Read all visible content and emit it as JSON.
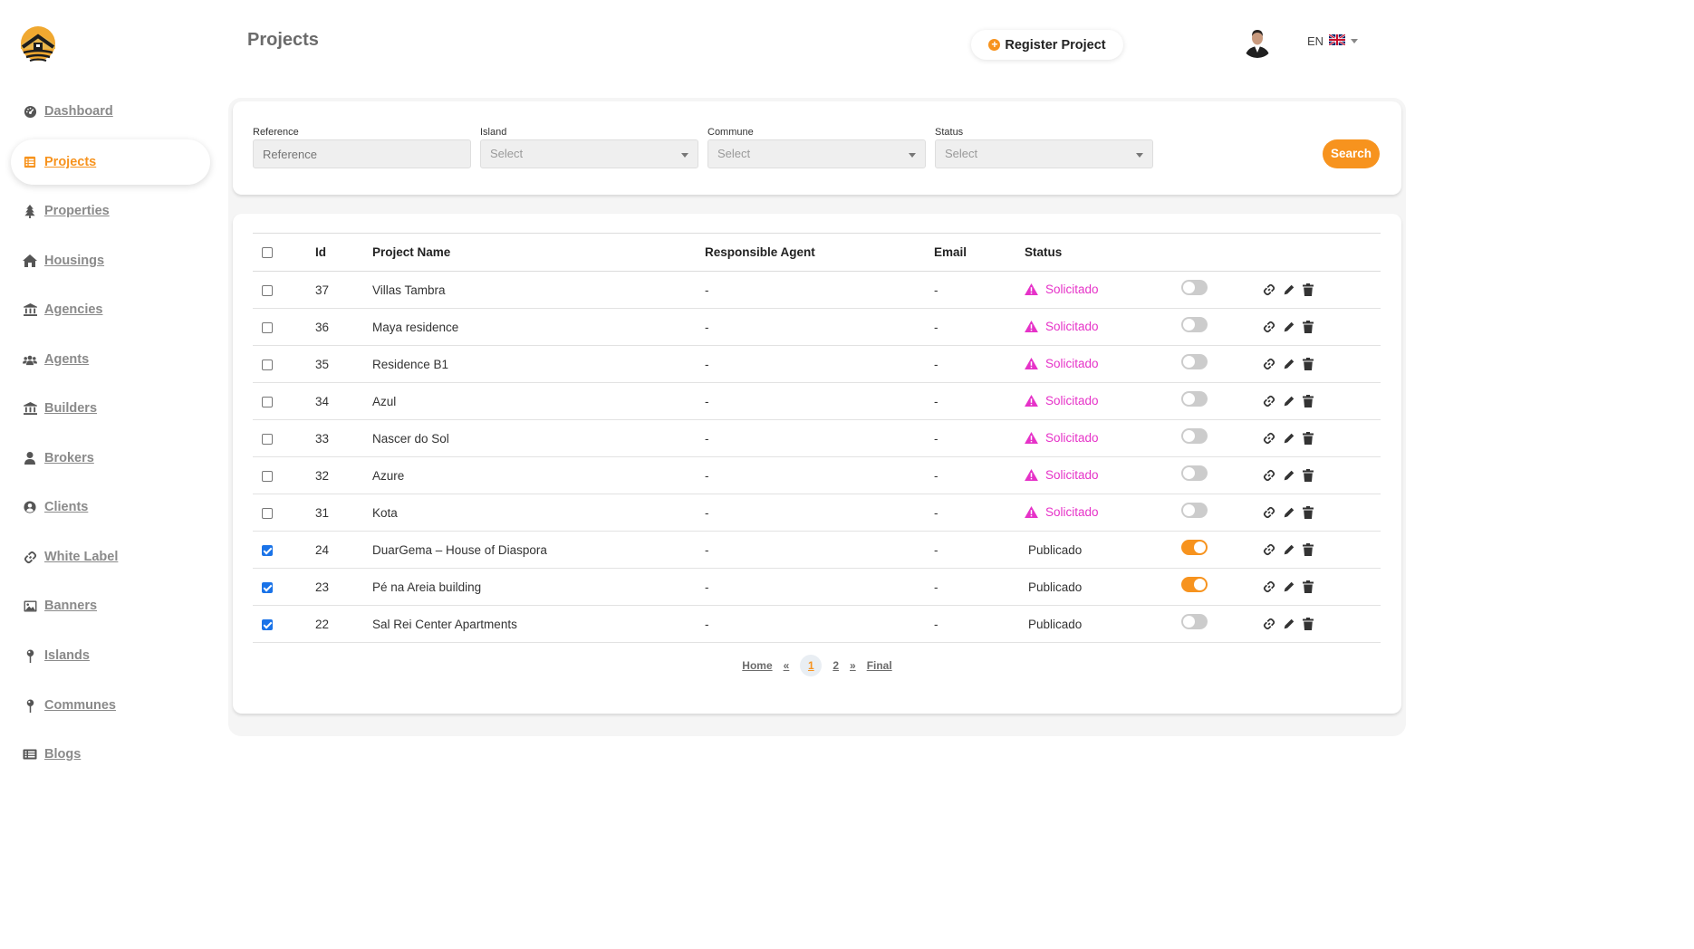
{
  "sidebar": {
    "items": [
      {
        "label": "Dashboard",
        "icon": "gauge-icon"
      },
      {
        "label": "Projects",
        "icon": "list-icon",
        "active": true
      },
      {
        "label": "Properties",
        "icon": "tree-icon"
      },
      {
        "label": "Housings",
        "icon": "house-icon"
      },
      {
        "label": "Agencies",
        "icon": "bank-icon"
      },
      {
        "label": "Agents",
        "icon": "users-icon"
      },
      {
        "label": "Builders",
        "icon": "bank-icon"
      },
      {
        "label": "Brokers",
        "icon": "user-icon"
      },
      {
        "label": "Clients",
        "icon": "user-circle-icon"
      },
      {
        "label": "White Label",
        "icon": "link-icon"
      },
      {
        "label": "Banners",
        "icon": "image-icon"
      },
      {
        "label": "Islands",
        "icon": "pin-icon"
      },
      {
        "label": "Communes",
        "icon": "pin-icon"
      },
      {
        "label": "Blogs",
        "icon": "list-alt-icon"
      }
    ]
  },
  "header": {
    "title": "Projects",
    "register_label": "Register Project",
    "lang": "EN"
  },
  "filters": {
    "reference": {
      "label": "Reference",
      "placeholder": "Reference"
    },
    "island": {
      "label": "Island",
      "value": "Select"
    },
    "commune": {
      "label": "Commune",
      "value": "Select"
    },
    "status": {
      "label": "Status",
      "value": "Select"
    },
    "search_label": "Search"
  },
  "table": {
    "headers": {
      "id": "Id",
      "name": "Project Name",
      "agent": "Responsible Agent",
      "email": "Email",
      "status": "Status"
    },
    "rows": [
      {
        "checked": false,
        "id": "37",
        "name": "Villas Tambra",
        "agent": "-",
        "email": "-",
        "status": "Solicitado",
        "warn": true,
        "toggle": false
      },
      {
        "checked": false,
        "id": "36",
        "name": "Maya residence",
        "agent": "-",
        "email": "-",
        "status": "Solicitado",
        "warn": true,
        "toggle": false
      },
      {
        "checked": false,
        "id": "35",
        "name": "Residence B1",
        "agent": "-",
        "email": "-",
        "status": "Solicitado",
        "warn": true,
        "toggle": false
      },
      {
        "checked": false,
        "id": "34",
        "name": "Azul",
        "agent": "-",
        "email": "-",
        "status": "Solicitado",
        "warn": true,
        "toggle": false
      },
      {
        "checked": false,
        "id": "33",
        "name": "Nascer do Sol",
        "agent": "-",
        "email": "-",
        "status": "Solicitado",
        "warn": true,
        "toggle": false
      },
      {
        "checked": false,
        "id": "32",
        "name": "Azure",
        "agent": "-",
        "email": "-",
        "status": "Solicitado",
        "warn": true,
        "toggle": false
      },
      {
        "checked": false,
        "id": "31",
        "name": "Kota",
        "agent": "-",
        "email": "-",
        "status": "Solicitado",
        "warn": true,
        "toggle": false
      },
      {
        "checked": true,
        "id": "24",
        "name": "DuarGema – House of Diaspora",
        "agent": "-",
        "email": "-",
        "status": "Publicado",
        "warn": false,
        "toggle": true
      },
      {
        "checked": true,
        "id": "23",
        "name": "Pé na Areia building",
        "agent": "-",
        "email": "-",
        "status": "Publicado",
        "warn": false,
        "toggle": true
      },
      {
        "checked": true,
        "id": "22",
        "name": "Sal Rei Center Apartments",
        "agent": "-",
        "email": "-",
        "status": "Publicado",
        "warn": false,
        "toggle": false
      }
    ]
  },
  "pagination": {
    "home": "Home",
    "prev": "«",
    "pages": [
      "1",
      "2"
    ],
    "current": "1",
    "next": "»",
    "final": "Final"
  },
  "colors": {
    "accent": "#f7931e",
    "warning": "#e632c8",
    "checkbox": "#1a73e8"
  }
}
